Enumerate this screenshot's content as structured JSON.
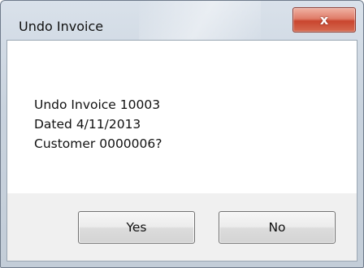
{
  "window": {
    "title": "Undo Invoice",
    "close_label": "x"
  },
  "message": {
    "line1": "Undo Invoice 10003",
    "line2": "Dated 4/11/2013",
    "line3": "Customer 0000006?"
  },
  "buttons": {
    "yes_label": "Yes",
    "no_label": "No"
  },
  "colors": {
    "close_button": "#d5553d",
    "titlebar": "#cfd8e2",
    "message_background": "#ffffff",
    "button_area_background": "#f0f0f0"
  }
}
